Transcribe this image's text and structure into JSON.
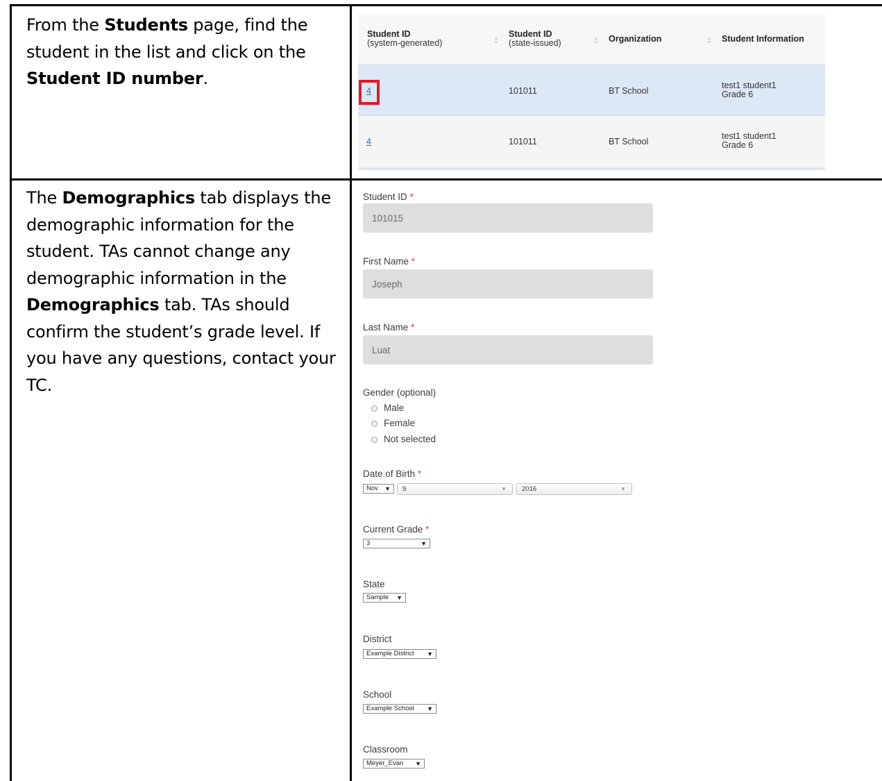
{
  "instructions": {
    "row1": {
      "p1": "From the ",
      "b1": "Students",
      "p2": " page, find the student in the list and click on the ",
      "b2": "Student ID number",
      "p3": "."
    },
    "row2": {
      "p1": "The ",
      "b1": "Demographics",
      "p2": " tab displays the demographic information for the student. TAs cannot change any demographic information in the ",
      "b2": "Demographics",
      "p3": " tab. TAs should confirm the student’s grade level. If you have any questions, contact your TC."
    }
  },
  "student_table": {
    "columns": [
      {
        "title": "Student ID",
        "subtitle": "(system-generated)"
      },
      {
        "title": "Student ID",
        "subtitle": "(state-issued)"
      },
      {
        "title": "Organization",
        "subtitle": ""
      },
      {
        "title": "Student Information",
        "subtitle": ""
      }
    ],
    "rows": [
      {
        "system_id": "4",
        "state_id": "101011",
        "organization": "BT School",
        "info_name": "test1 student1",
        "info_grade": "Grade 6",
        "highlighted": true
      },
      {
        "system_id": "4",
        "state_id": "101011",
        "organization": "BT School",
        "info_name": "test1 student1",
        "info_grade": "Grade 6",
        "highlighted": false
      }
    ],
    "highlight_color": "#e0182b"
  },
  "demographics": {
    "required_mark": "*",
    "student_id": {
      "label": "Student ID",
      "value": "101015"
    },
    "first_name": {
      "label": "First Name",
      "value": "Joseph"
    },
    "last_name": {
      "label": "Last Name",
      "value": "Luat"
    },
    "gender": {
      "label": "Gender (optional)",
      "options": [
        "Male",
        "Female",
        "Not selected"
      ]
    },
    "dob": {
      "label": "Date of Birth",
      "month": "Nov",
      "day": "9",
      "year": "2016"
    },
    "current_grade": {
      "label": "Current Grade",
      "value": "3"
    },
    "state": {
      "label": "State",
      "value": "Sample"
    },
    "district": {
      "label": "District",
      "value": "Example District"
    },
    "school": {
      "label": "School",
      "value": "Example School"
    },
    "classroom": {
      "label": "Classroom",
      "value": "Meyer_Evan"
    }
  }
}
